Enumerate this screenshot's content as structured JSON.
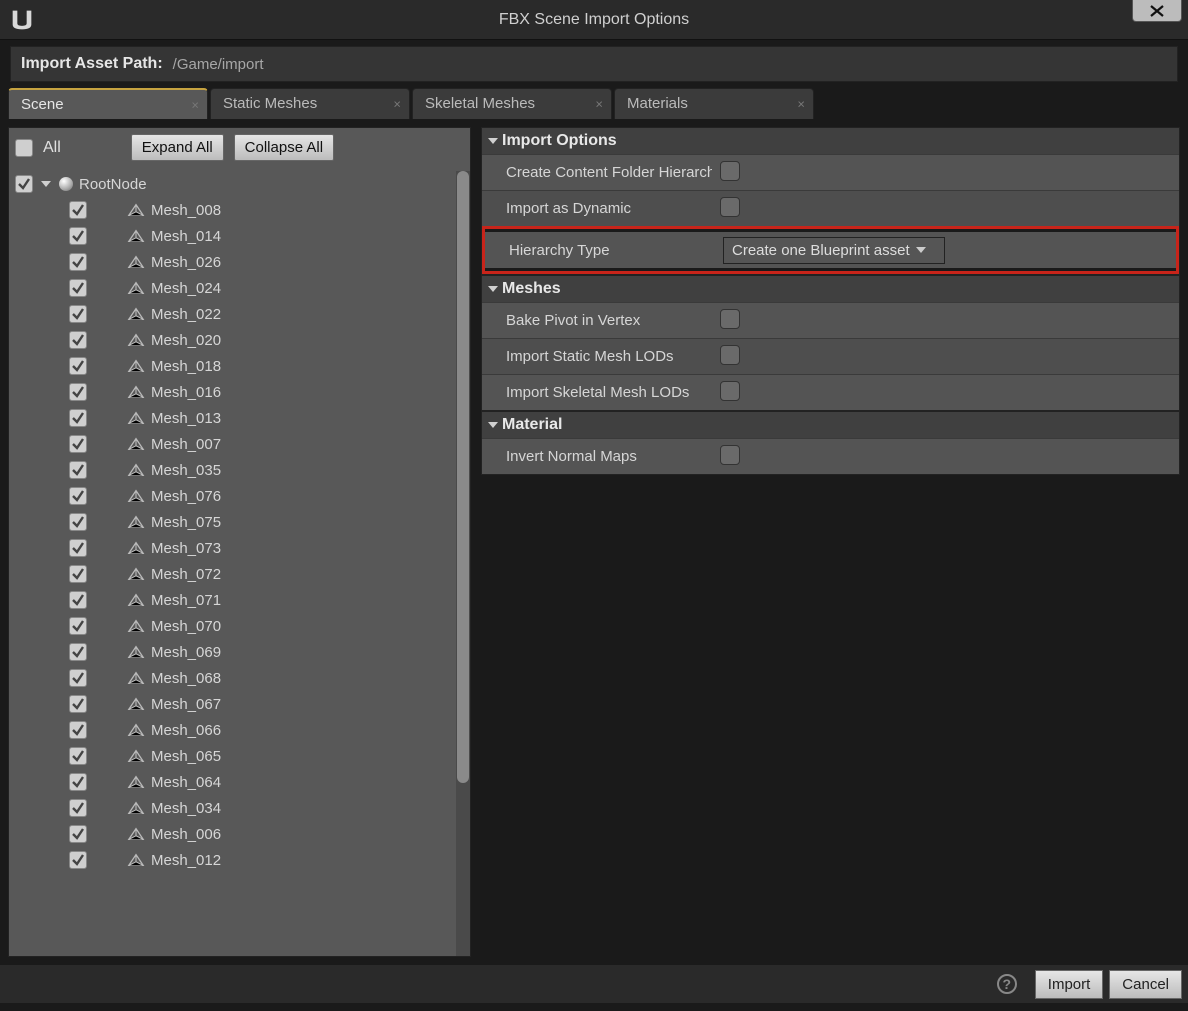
{
  "window": {
    "title": "FBX Scene Import Options"
  },
  "path": {
    "label": "Import Asset Path:",
    "value": "/Game/import"
  },
  "tabs": [
    {
      "label": "Scene",
      "active": true
    },
    {
      "label": "Static Meshes",
      "active": false
    },
    {
      "label": "Skeletal Meshes",
      "active": false
    },
    {
      "label": "Materials",
      "active": false
    }
  ],
  "toolbar": {
    "all_label": "All",
    "expand_label": "Expand All",
    "collapse_label": "Collapse All"
  },
  "tree": {
    "root": "RootNode",
    "items": [
      "Mesh_008",
      "Mesh_014",
      "Mesh_026",
      "Mesh_024",
      "Mesh_022",
      "Mesh_020",
      "Mesh_018",
      "Mesh_016",
      "Mesh_013",
      "Mesh_007",
      "Mesh_035",
      "Mesh_076",
      "Mesh_075",
      "Mesh_073",
      "Mesh_072",
      "Mesh_071",
      "Mesh_070",
      "Mesh_069",
      "Mesh_068",
      "Mesh_067",
      "Mesh_066",
      "Mesh_065",
      "Mesh_064",
      "Mesh_034",
      "Mesh_006",
      "Mesh_012"
    ]
  },
  "panels": {
    "import_options": {
      "title": "Import Options",
      "create_content_folder": {
        "label": "Create Content Folder Hierarchy",
        "value": false
      },
      "import_as_dynamic": {
        "label": "Import as Dynamic",
        "value": false
      },
      "hierarchy_type": {
        "label": "Hierarchy Type",
        "value": "Create one Blueprint asset"
      }
    },
    "meshes": {
      "title": "Meshes",
      "bake_pivot": {
        "label": "Bake Pivot in Vertex",
        "value": false
      },
      "static_lods": {
        "label": "Import Static Mesh LODs",
        "value": false
      },
      "skeletal_lods": {
        "label": "Import Skeletal Mesh LODs",
        "value": false
      }
    },
    "material": {
      "title": "Material",
      "invert_normal": {
        "label": "Invert Normal Maps",
        "value": false
      }
    }
  },
  "footer": {
    "import": "Import",
    "cancel": "Cancel"
  }
}
